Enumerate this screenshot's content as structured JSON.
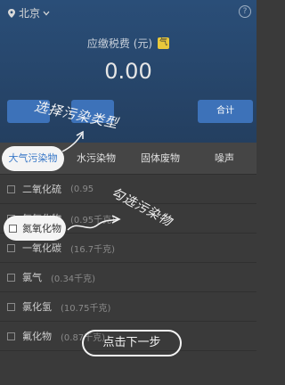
{
  "header": {
    "city": "北京",
    "help_label": "?",
    "tax_label": "应缴税费 (元)",
    "tax_badge": "气",
    "amount": "0.00",
    "total_button": "合计"
  },
  "tabs": [
    {
      "label": "大气污染物"
    },
    {
      "label": "水污染物"
    },
    {
      "label": "固体废物"
    },
    {
      "label": "噪声"
    }
  ],
  "pollutants": [
    {
      "name": "二氧化硫",
      "amount": "(0.95"
    },
    {
      "name": "氮氧化物",
      "amount": "(0.95千克)"
    },
    {
      "name": "一氧化碳",
      "amount": "(16.7千克)"
    },
    {
      "name": "氯气",
      "amount": "(0.34千克)"
    },
    {
      "name": "氯化氢",
      "amount": "(10.75千克)"
    },
    {
      "name": "氟化物",
      "amount": "(0.87千克)"
    }
  ],
  "annotations": {
    "select_type": "选择污染类型",
    "select_pollutant": "勾选污染物",
    "next_step": "点击下一步"
  }
}
